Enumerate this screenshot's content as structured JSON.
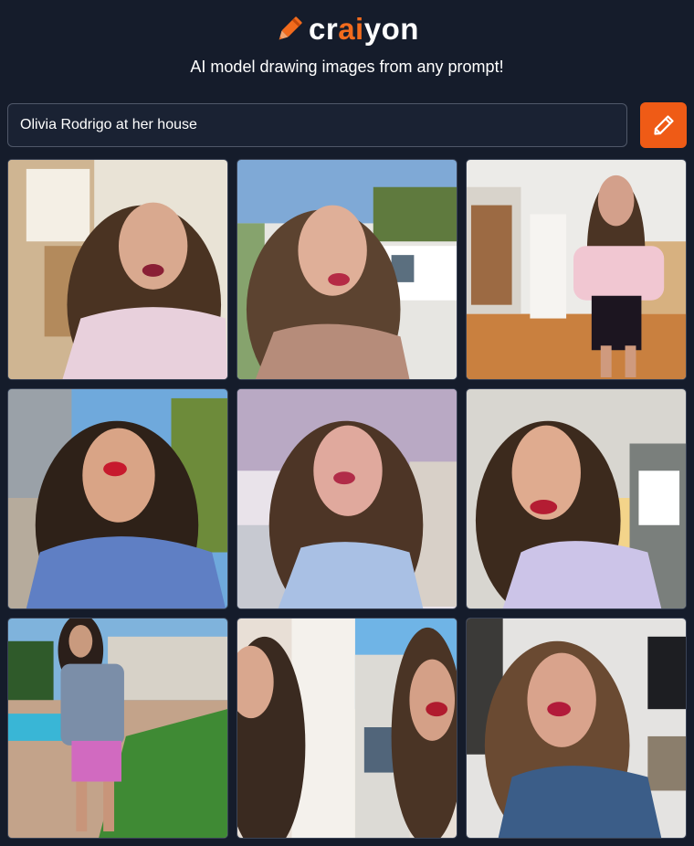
{
  "app": {
    "logo_pre": "cr",
    "logo_ai": "ai",
    "logo_post": "yon",
    "tagline": "AI model drawing images from any prompt!",
    "accent_color": "#f26b1d",
    "background_color": "#151c2b"
  },
  "prompt": {
    "value": "Olivia Rodrigo at her house",
    "icon": "pencil-icon"
  },
  "results": {
    "count": 9,
    "items": [
      {
        "alt": "generated-image-1"
      },
      {
        "alt": "generated-image-2"
      },
      {
        "alt": "generated-image-3"
      },
      {
        "alt": "generated-image-4"
      },
      {
        "alt": "generated-image-5"
      },
      {
        "alt": "generated-image-6"
      },
      {
        "alt": "generated-image-7"
      },
      {
        "alt": "generated-image-8"
      },
      {
        "alt": "generated-image-9"
      }
    ]
  }
}
